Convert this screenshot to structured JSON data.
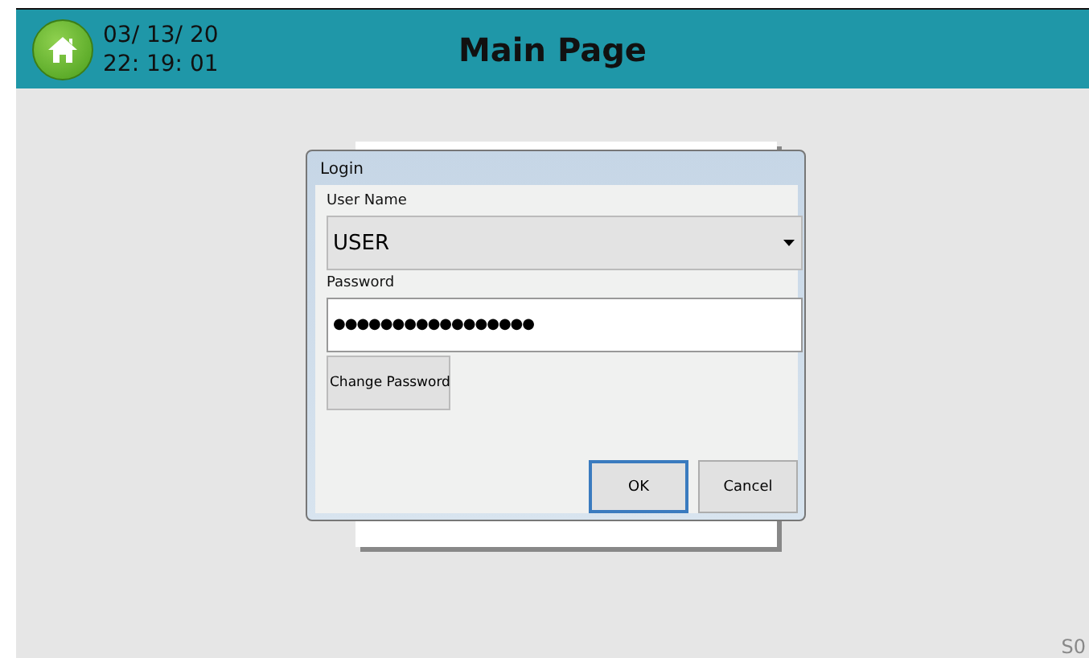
{
  "header": {
    "date": "03/ 13/ 20",
    "time": "22: 19: 01",
    "title": "Main Page"
  },
  "login_dialog": {
    "title": "Login",
    "user_name_label": "User Name",
    "user_name_value": "USER",
    "password_label": "Password",
    "password_value": "●●●●●●●●●●●●●●●●●",
    "change_password_button": "Change Password",
    "buttons": [
      {
        "label": "OK",
        "selected": true
      },
      {
        "label": "Cancel",
        "selected": false
      }
    ]
  },
  "corner_label": "S0"
}
